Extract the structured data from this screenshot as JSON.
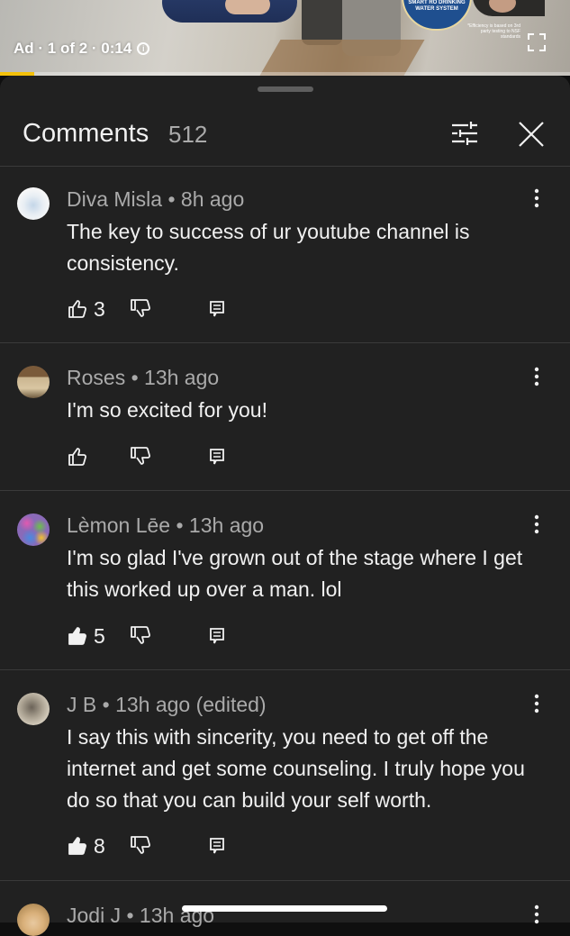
{
  "ad": {
    "label": "Ad · 1 of 2 · 0:14",
    "badge_text": "SMART RO DRINKING WATER SYSTEM",
    "fine_print": "*Efficiency is based on 3rd party testing to NSF standards",
    "progress": 0.06,
    "progress_color": "#f4c10b"
  },
  "header": {
    "title": "Comments",
    "count": "512"
  },
  "comments": [
    {
      "author": "Diva Misla",
      "time": "• 8h ago",
      "text": "The key to success of ur youtube channel is consistency.",
      "likes": "3",
      "liked": false
    },
    {
      "author": "Roses",
      "time": "• 13h ago",
      "text": "I'm so excited for you!",
      "likes": "",
      "liked": false
    },
    {
      "author": "Lèmon Lēe",
      "time": "• 13h ago",
      "text": "I'm so glad I've grown out of the stage where I get this worked up over a man. lol",
      "likes": "5",
      "liked": true
    },
    {
      "author": "J B",
      "time": "• 13h ago (edited)",
      "text": "I say this with sincerity, you need to get off the internet and get some counseling. I truly hope you do so that you can build your self worth.",
      "likes": "8",
      "liked": true
    },
    {
      "author": "Jodi J",
      "time": "• 13h ago",
      "text": "",
      "likes": "",
      "liked": false
    }
  ],
  "icons": [
    "info-icon",
    "fullscreen-icon",
    "filter-icon",
    "close-icon",
    "kebab-icon",
    "thumbs-up-icon",
    "thumbs-down-icon",
    "reply-icon"
  ]
}
